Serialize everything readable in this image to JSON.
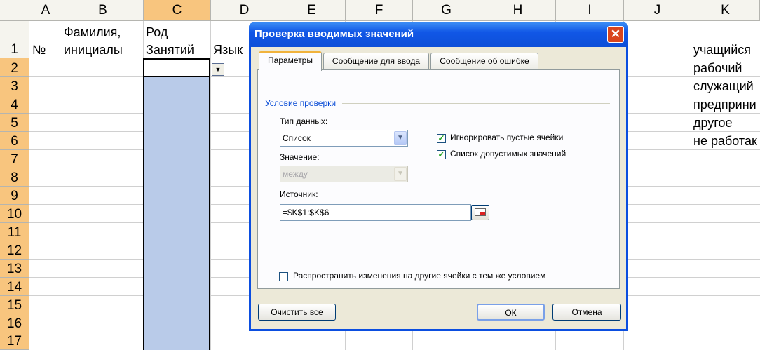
{
  "sheet": {
    "columns": [
      "A",
      "B",
      "C",
      "D",
      "E",
      "F",
      "G",
      "H",
      "I",
      "J",
      "K"
    ],
    "active_column": "C",
    "rows": [
      "1",
      "2",
      "3",
      "4",
      "5",
      "6",
      "7",
      "8",
      "9",
      "10",
      "11",
      "12",
      "13",
      "14",
      "15",
      "16",
      "17"
    ],
    "active_row_start": "2",
    "cells": {
      "A1": "№",
      "B1_line1": "Фамилия,",
      "B1_line2": "инициалы",
      "C1_line1": "Род",
      "C1_line2": "Занятий",
      "D1": "Язык",
      "K1": "учащийся",
      "K2": "рабочий",
      "K3": "служащий",
      "K4": "предприни",
      "K5": "другое",
      "K6": "не работак"
    },
    "dropdown_arrow_icon": "chevron-down-icon"
  },
  "dialog": {
    "title": "Проверка вводимых значений",
    "close_icon": "close-icon",
    "tabs": [
      "Параметры",
      "Сообщение для ввода",
      "Сообщение об ошибке"
    ],
    "active_tab": "Параметры",
    "group_title": "Условие проверки",
    "data_type_label": "Тип данных:",
    "data_type_value": "Список",
    "value_label": "Значение:",
    "value_value": "между",
    "ignore_blank_label": "Игнорировать пустые ячейки",
    "ignore_blank_checked": true,
    "in_cell_dropdown_label": "Список допустимых значений",
    "in_cell_dropdown_checked": true,
    "source_label": "Источник:",
    "source_value": "=$K$1:$K$6",
    "apply_all_label": "Распространить изменения на другие ячейки с тем же условием",
    "apply_all_checked": false,
    "clear_all_button": "Очистить все",
    "ok_button": "ОК",
    "cancel_button": "Отмена"
  },
  "colors": {
    "header_bg": "#f5f4ee",
    "active_header_bg": "#f8c57e",
    "selection_bg": "#b9cbe9",
    "dialog_titlebar": "#0d4fd8",
    "dialog_bg": "#ece9d8",
    "close_button": "#d9451e"
  }
}
